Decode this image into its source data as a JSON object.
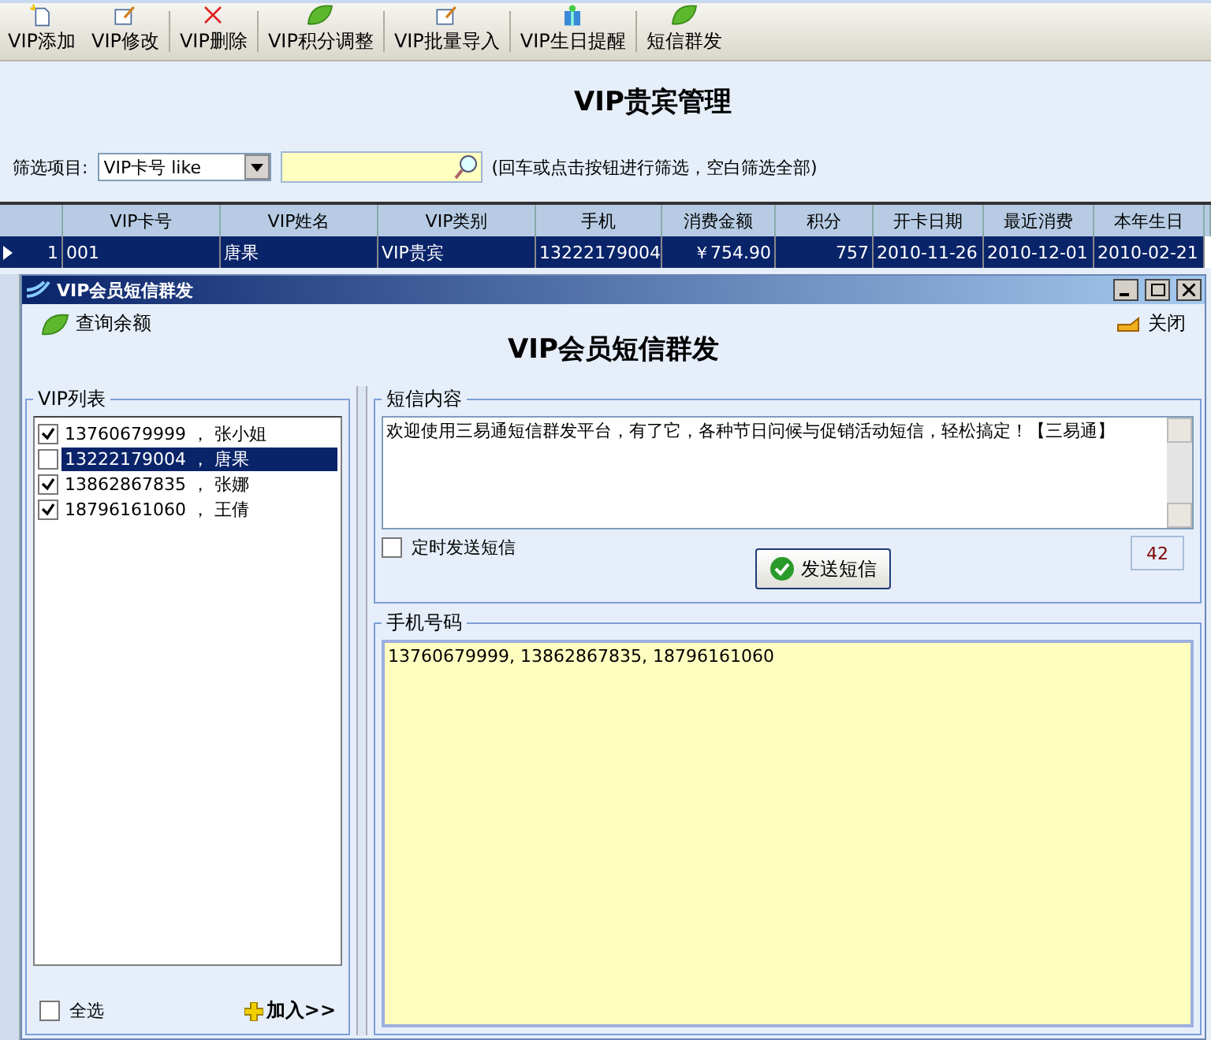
{
  "toolbar": [
    {
      "label": "VIP添加"
    },
    {
      "label": "VIP修改"
    },
    {
      "label": "VIP删除"
    },
    {
      "label": "VIP积分调整"
    },
    {
      "label": "VIP批量导入"
    },
    {
      "label": "VIP生日提醒"
    },
    {
      "label": "短信群发"
    }
  ],
  "page_title": "VIP贵宾管理",
  "filter": {
    "label": "筛选项目:",
    "field": "VIP卡号 like",
    "hint": "(回车或点击按钮进行筛选，空白筛选全部)"
  },
  "table": {
    "columns": [
      "VIP卡号",
      "VIP姓名",
      "VIP类别",
      "手机",
      "消费金额",
      "积分",
      "开卡日期",
      "最近消费",
      "本年生日"
    ],
    "rows": [
      {
        "number": "1",
        "selected": true,
        "cells": [
          "001",
          "唐果",
          "VIP贵宾",
          "13222179004",
          "￥754.90",
          "757",
          "2010-11-26",
          "2010-12-01",
          "2010-02-21"
        ]
      }
    ]
  },
  "dialog": {
    "title": "VIP会员短信群发",
    "query_button": "查询余额",
    "close_button": "关闭",
    "heading": "VIP会员短信群发",
    "vip_list": {
      "title": "VIP列表",
      "items": [
        {
          "text": "13760679999 ， 张小姐",
          "checked": true,
          "selected": false
        },
        {
          "text": "13222179004 ， 唐果",
          "checked": false,
          "selected": true
        },
        {
          "text": "13862867835 ， 张娜",
          "checked": true,
          "selected": false
        },
        {
          "text": "18796161060 ， 王倩",
          "checked": true,
          "selected": false
        }
      ],
      "select_all": {
        "label": "全选",
        "checked": false
      },
      "add_button": "加入>>"
    },
    "sms": {
      "title": "短信内容",
      "content": "欢迎使用三易通短信群发平台，有了它，各种节日问候与促销活动短信，轻松搞定！【三易通】",
      "timed": {
        "label": "定时发送短信",
        "checked": false
      },
      "send_button": "发送短信",
      "count": "42"
    },
    "phones": {
      "title": "手机号码",
      "value": "13760679999, 13862867835, 18796161060"
    }
  }
}
